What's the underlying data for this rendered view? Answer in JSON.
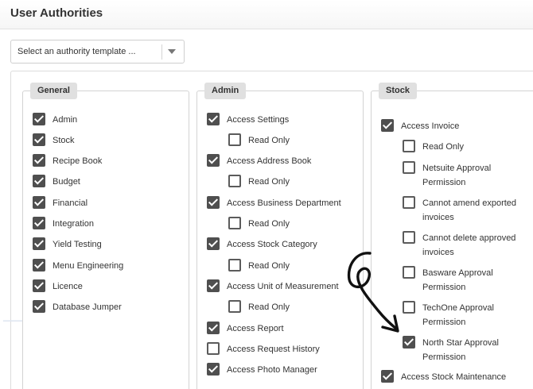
{
  "header": {
    "title": "User Authorities"
  },
  "template_select": {
    "selected": "Select an authority template ..."
  },
  "groups": {
    "general": {
      "title": "General",
      "items": [
        {
          "label": "Admin",
          "checked": true
        },
        {
          "label": "Stock",
          "checked": true
        },
        {
          "label": "Recipe Book",
          "checked": true
        },
        {
          "label": "Budget",
          "checked": true
        },
        {
          "label": "Financial",
          "checked": true
        },
        {
          "label": "Integration",
          "checked": true
        },
        {
          "label": "Yield Testing",
          "checked": true
        },
        {
          "label": "Menu Engineering",
          "checked": true
        },
        {
          "label": "Licence",
          "checked": true
        },
        {
          "label": "Database Jumper",
          "checked": true
        }
      ]
    },
    "admin": {
      "title": "Admin",
      "items": [
        {
          "label": "Access Settings",
          "checked": true
        },
        {
          "label": "Read Only",
          "checked": false
        },
        {
          "label": "Access Address Book",
          "checked": true
        },
        {
          "label": "Read Only",
          "checked": false
        },
        {
          "label": "Access Business Department",
          "checked": true
        },
        {
          "label": "Read Only",
          "checked": false
        },
        {
          "label": "Access Stock Category",
          "checked": true
        },
        {
          "label": "Read Only",
          "checked": false
        },
        {
          "label": "Access Unit of Measurement",
          "checked": true
        },
        {
          "label": "Read Only",
          "checked": false
        },
        {
          "label": "Access Report",
          "checked": true
        },
        {
          "label": "Access Request History",
          "checked": false
        },
        {
          "label": "Access Photo Manager",
          "checked": true
        }
      ]
    },
    "stock": {
      "title": "Stock",
      "items": [
        {
          "label": "Access Invoice",
          "checked": true
        },
        {
          "label": "Read Only",
          "checked": false
        },
        {
          "label": "Netsuite Approval Permission",
          "lines": [
            "Netsuite Approval",
            "Permission"
          ],
          "checked": false
        },
        {
          "label": "Cannot amend exported invoices",
          "lines": [
            "Cannot amend exported",
            "invoices"
          ],
          "checked": false
        },
        {
          "label": "Cannot delete approved invoices",
          "lines": [
            "Cannot delete approved",
            "invoices"
          ],
          "checked": false
        },
        {
          "label": "Basware Approval Permission",
          "lines": [
            "Basware Approval",
            "Permission"
          ],
          "checked": false
        },
        {
          "label": "TechOne Approval Permission",
          "lines": [
            "TechOne Approval",
            "Permission"
          ],
          "checked": false
        },
        {
          "label": "North Star Approval Permission",
          "lines": [
            "North Star Approval",
            "Permission"
          ],
          "checked": true
        },
        {
          "label": "Access Stock Maintenance",
          "checked": true
        }
      ]
    }
  },
  "colors": {
    "checkbox_fill": "#4f4f4f",
    "group_header_bg": "#e0e0e0",
    "annotation_arrow": "#111111"
  }
}
